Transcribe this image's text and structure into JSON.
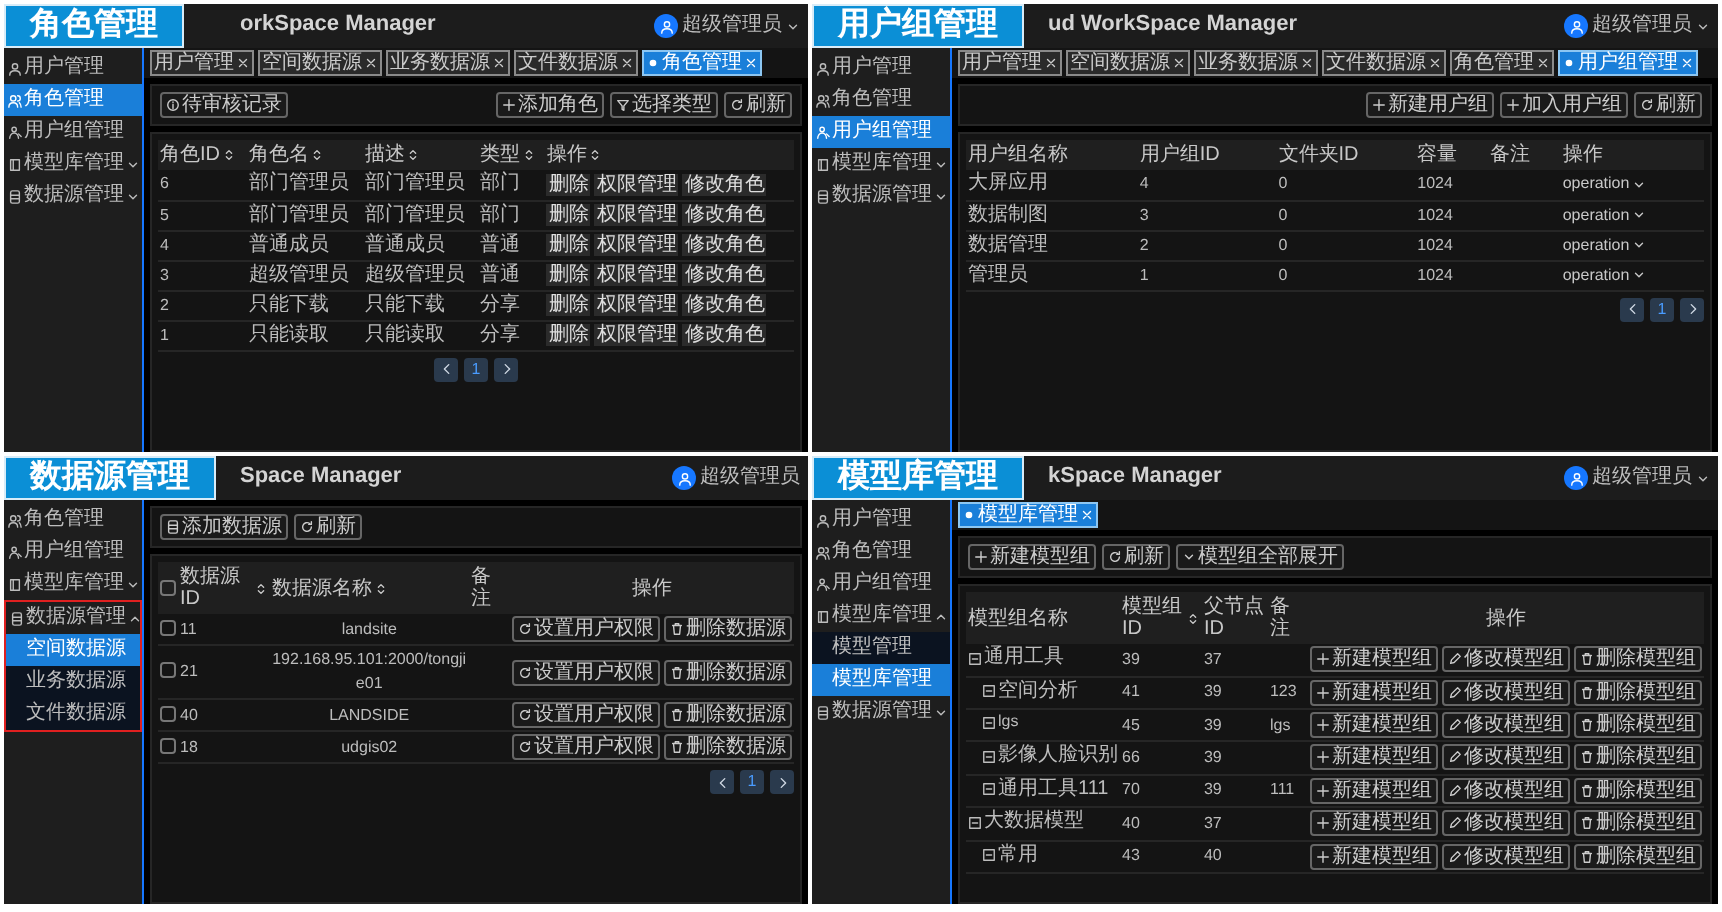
{
  "panels": [
    {
      "kind": "role",
      "caption": "角色管理",
      "app_title": "orkSpace Manager",
      "user": {
        "name": "超级管理员",
        "dropdown": true
      },
      "sidebar": [
        {
          "label": "用户管理",
          "selected": false
        },
        {
          "label": "角色管理",
          "selected": true
        },
        {
          "label": "用户组管理",
          "selected": false
        },
        {
          "label": "模型库管理",
          "selected": false,
          "expanded": false
        },
        {
          "label": "数据源管理",
          "selected": false,
          "expanded": false
        }
      ],
      "tabs": [
        {
          "label": "用户管理",
          "selected": false
        },
        {
          "label": "空间数据源",
          "selected": false
        },
        {
          "label": "业务数据源",
          "selected": false
        },
        {
          "label": "文件数据源",
          "selected": false
        },
        {
          "label": "角色管理",
          "selected": true
        }
      ],
      "toolbar": {
        "left": [
          "待审核记录"
        ],
        "right": [
          "添加角色",
          "选择类型",
          "刷新"
        ]
      },
      "table": {
        "columns": [
          {
            "label": "角色ID",
            "sortable": true
          },
          {
            "label": "角色名",
            "sortable": true
          },
          {
            "label": "描述",
            "sortable": true
          },
          {
            "label": "类型",
            "sortable": true
          },
          {
            "label": "操作",
            "sortable": true
          }
        ],
        "rows": [
          {
            "cells": [
              "6",
              "部门管理员",
              "部门管理员",
              "部门"
            ],
            "actions": [
              "删除",
              "权限管理",
              "修改角色"
            ]
          },
          {
            "cells": [
              "5",
              "部门管理员",
              "部门管理员",
              "部门"
            ],
            "actions": [
              "删除",
              "权限管理",
              "修改角色"
            ]
          },
          {
            "cells": [
              "4",
              "普通成员",
              "普通成员",
              "普通"
            ],
            "actions": [
              "删除",
              "权限管理",
              "修改角色"
            ]
          },
          {
            "cells": [
              "3",
              "超级管理员",
              "超级管理员",
              "普通"
            ],
            "actions": [
              "删除",
              "权限管理",
              "修改角色"
            ]
          },
          {
            "cells": [
              "2",
              "只能下载",
              "只能下载",
              "分享"
            ],
            "actions": [
              "删除",
              "权限管理",
              "修改角色"
            ]
          },
          {
            "cells": [
              "1",
              "只能读取",
              "只能读取",
              "分享"
            ],
            "actions": [
              "删除",
              "权限管理",
              "修改角色"
            ]
          }
        ]
      },
      "pagination": [
        {
          "label": "1",
          "selected": true
        }
      ]
    },
    {
      "kind": "group",
      "caption": "用户组管理",
      "app_title": "ud WorkSpace Manager",
      "user": {
        "name": "超级管理员",
        "dropdown": true
      },
      "sidebar": [
        {
          "label": "用户管理",
          "selected": false
        },
        {
          "label": "角色管理",
          "selected": false
        },
        {
          "label": "用户组管理",
          "selected": true
        },
        {
          "label": "模型库管理",
          "selected": false,
          "expanded": false
        },
        {
          "label": "数据源管理",
          "selected": false,
          "expanded": false
        }
      ],
      "tabs": [
        {
          "label": "用户管理",
          "selected": false
        },
        {
          "label": "空间数据源",
          "selected": false
        },
        {
          "label": "业务数据源",
          "selected": false
        },
        {
          "label": "文件数据源",
          "selected": false
        },
        {
          "label": "角色管理",
          "selected": false
        },
        {
          "label": "用户组管理",
          "selected": true
        }
      ],
      "toolbar": {
        "right": [
          "新建用户组",
          "加入用户组",
          "刷新"
        ]
      },
      "table": {
        "columns": [
          {
            "label": "用户组名称",
            "sortable": false
          },
          {
            "label": "用户组ID",
            "sortable": false
          },
          {
            "label": "文件夹ID",
            "sortable": false
          },
          {
            "label": "容量",
            "sortable": false
          },
          {
            "label": "备注",
            "sortable": false
          },
          {
            "label": "操作",
            "sortable": false
          }
        ],
        "rows": [
          {
            "cells": [
              "大屏应用",
              "4",
              "0",
              "1024"
            ],
            "actions": [
              "operation"
            ]
          },
          {
            "cells": [
              "数据制图",
              "3",
              "0",
              "1024"
            ],
            "actions": [
              "operation"
            ]
          },
          {
            "cells": [
              "数据管理",
              "2",
              "0",
              "1024"
            ],
            "actions": [
              "operation"
            ]
          },
          {
            "cells": [
              "管理员",
              "1",
              "0",
              "1024"
            ],
            "actions": [
              "operation"
            ]
          }
        ]
      },
      "pagination": [
        {
          "label": "1",
          "selected": true
        }
      ]
    },
    {
      "kind": "datasource",
      "caption": "数据源管理",
      "app_title": "Space Manager",
      "user": {
        "name": "超级管理员",
        "dropdown": false
      },
      "sidebar": [
        {
          "label": "角色管理",
          "selected": false
        },
        {
          "label": "用户组管理",
          "selected": false
        },
        {
          "label": "模型库管理",
          "selected": false,
          "expanded": false
        },
        {
          "label": "数据源管理",
          "selected": false,
          "expanded": true,
          "highlighted": true,
          "children": [
            {
              "label": "空间数据源",
              "selected": true
            },
            {
              "label": "业务数据源",
              "selected": false
            },
            {
              "label": "文件数据源",
              "selected": false
            }
          ]
        }
      ],
      "toolbar": {
        "left": [
          "添加数据源",
          "刷新"
        ]
      },
      "table": {
        "select_all_checked": false,
        "columns": [
          {
            "label": "数据源ID",
            "sortable": true
          },
          {
            "label": "数据源名称",
            "sortable": true
          },
          {
            "label": "备注",
            "sortable": false
          },
          {
            "label": "操作",
            "sortable": false
          }
        ],
        "rows": [
          {
            "checked": false,
            "cells": [
              "11",
              "landsite"
            ],
            "actions": [
              "设置用户权限",
              "删除数据源"
            ]
          },
          {
            "checked": false,
            "cells": [
              "21",
              "192.168.95.101:2000/tongjie01"
            ],
            "actions": [
              "设置用户权限",
              "删除数据源"
            ]
          },
          {
            "checked": false,
            "cells": [
              "40",
              "LANDSIDE"
            ],
            "actions": [
              "设置用户权限",
              "删除数据源"
            ]
          },
          {
            "checked": false,
            "cells": [
              "18",
              "udgis02"
            ],
            "actions": [
              "设置用户权限",
              "删除数据源"
            ]
          }
        ]
      },
      "pagination": [
        {
          "label": "1",
          "selected": true
        }
      ]
    },
    {
      "kind": "model",
      "caption": "模型库管理",
      "app_title": "kSpace Manager",
      "user": {
        "name": "超级管理员",
        "dropdown": true
      },
      "sidebar": [
        {
          "label": "用户管理",
          "selected": false
        },
        {
          "label": "角色管理",
          "selected": false
        },
        {
          "label": "用户组管理",
          "selected": false
        },
        {
          "label": "模型库管理",
          "selected": false,
          "expanded": true,
          "children": [
            {
              "label": "模型管理",
              "selected": false
            },
            {
              "label": "模型库管理",
              "selected": true
            }
          ]
        },
        {
          "label": "数据源管理",
          "selected": false,
          "expanded": false
        }
      ],
      "tabs": [
        {
          "label": "模型库管理",
          "selected": true
        }
      ],
      "toolbar": {
        "left": [
          "新建模型组",
          "刷新",
          "模型组全部展开"
        ]
      },
      "table": {
        "columns": [
          {
            "label": "模型组名称",
            "sortable": false
          },
          {
            "label": "模型组ID",
            "sortable": true
          },
          {
            "label": "父节点ID",
            "sortable": false
          },
          {
            "label": "备注",
            "sortable": false
          },
          {
            "label": "操作",
            "sortable": false
          }
        ],
        "rows": [
          {
            "cells": [
              "通用工具",
              "39",
              "37"
            ],
            "actions": [
              "新建模型组",
              "修改模型组",
              "删除模型组"
            ],
            "children": [
              {
                "cells": [
                  "空间分析",
                  "41",
                  "39",
                  "123"
                ],
                "actions": [
                  "新建模型组",
                  "修改模型组",
                  "删除模型组"
                ]
              },
              {
                "cells": [
                  "lgs",
                  "45",
                  "39",
                  "lgs"
                ],
                "actions": [
                  "新建模型组",
                  "修改模型组",
                  "删除模型组"
                ]
              },
              {
                "cells": [
                  "影像人脸识别",
                  "66",
                  "39"
                ],
                "actions": [
                  "新建模型组",
                  "修改模型组",
                  "删除模型组"
                ]
              },
              {
                "cells": [
                  "通用工具111",
                  "70",
                  "39",
                  "111"
                ],
                "actions": [
                  "新建模型组",
                  "修改模型组",
                  "删除模型组"
                ]
              }
            ]
          },
          {
            "cells": [
              "大数据模型",
              "40",
              "37"
            ],
            "actions": [
              "新建模型组",
              "修改模型组",
              "删除模型组"
            ],
            "children": [
              {
                "cells": [
                  "常用",
                  "43",
                  "40"
                ],
                "actions": [
                  "新建模型组",
                  "修改模型组",
                  "删除模型组"
                ]
              }
            ]
          }
        ]
      }
    }
  ]
}
